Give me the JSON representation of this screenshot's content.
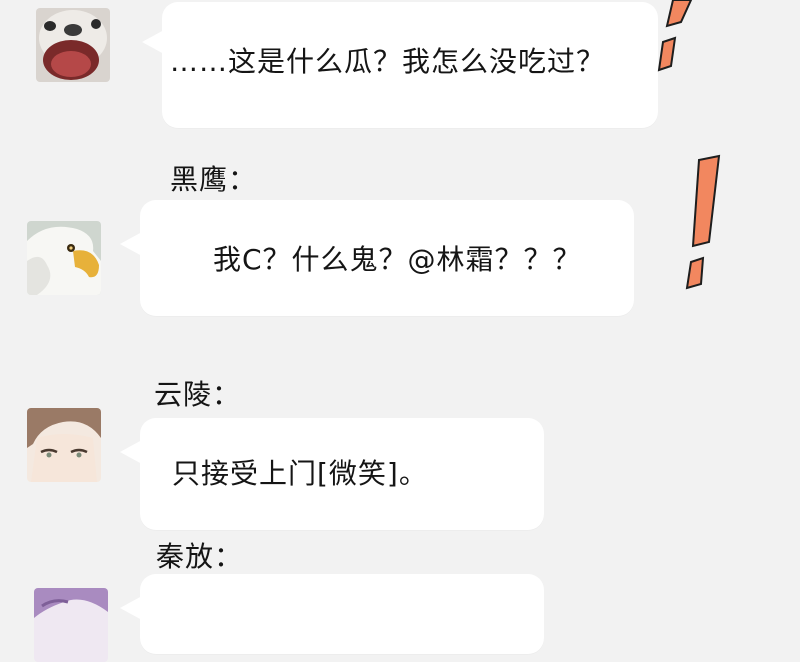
{
  "messages": [
    {
      "name": "",
      "avatar": "dog-avatar",
      "text": "……这是什么瓜？我怎么没吃过？"
    },
    {
      "name": "黑鹰：",
      "avatar": "eagle-avatar",
      "text": "我C？什么鬼？@林霜？？？"
    },
    {
      "name": "云陵：",
      "avatar": "man-avatar",
      "text": "只接受上门[微笑]。"
    },
    {
      "name": "秦放：",
      "avatar": "purple-hair-avatar",
      "text": ""
    }
  ],
  "decorations": {
    "exclamation_color": "#f2875f",
    "exclamation_icon": "exclamation-icon"
  }
}
